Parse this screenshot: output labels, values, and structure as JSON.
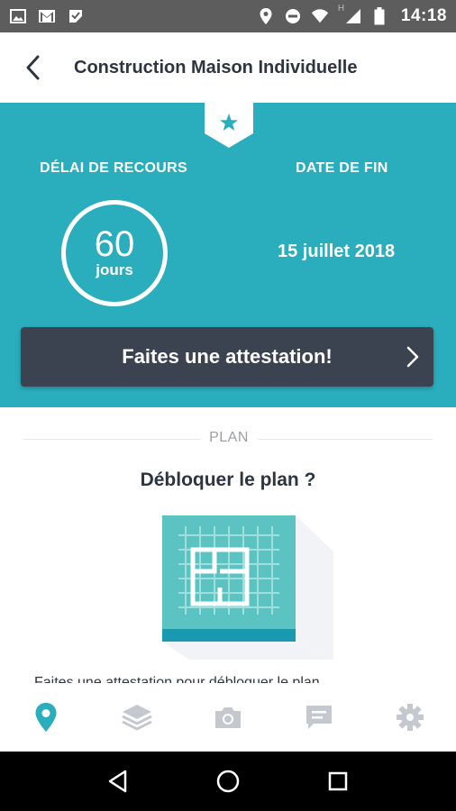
{
  "status_bar": {
    "time": "14:18",
    "network_letter": "H",
    "left_icons": [
      "image-icon",
      "gmail-icon",
      "checklist-icon"
    ],
    "right_icons": [
      "location-icon",
      "do-not-disturb-icon",
      "wifi-icon",
      "signal-icon",
      "battery-icon"
    ]
  },
  "header": {
    "title": "Construction Maison Individuelle",
    "back_icon": "chevron-left-icon"
  },
  "hero": {
    "background_color": "#2aadbc",
    "ribbon_icon": "star-icon",
    "delay_label": "DÉLAI DE RECOURS",
    "delay_value": "60",
    "delay_unit": "jours",
    "end_label": "DATE DE FIN",
    "end_date": "15 juillet 2018",
    "cta_label": "Faites une attestation!",
    "cta_icon": "chevron-right-icon"
  },
  "plan": {
    "section_label": "PLAN",
    "question": "Débloquer le plan ?",
    "illustration_icon": "floor-plan-icon",
    "truncated_text": "Faites une attestation pour débloquer le plan"
  },
  "bottom_nav": {
    "active_color": "#2aadbc",
    "inactive_color": "#c5c9cf",
    "items": [
      {
        "icon": "map-pin-icon",
        "active": true
      },
      {
        "icon": "layers-icon",
        "active": false
      },
      {
        "icon": "camera-icon",
        "active": false
      },
      {
        "icon": "chat-icon",
        "active": false
      },
      {
        "icon": "settings-icon",
        "active": false
      }
    ]
  },
  "system_nav": {
    "items": [
      "back-triangle-icon",
      "home-circle-icon",
      "recents-square-icon"
    ]
  }
}
